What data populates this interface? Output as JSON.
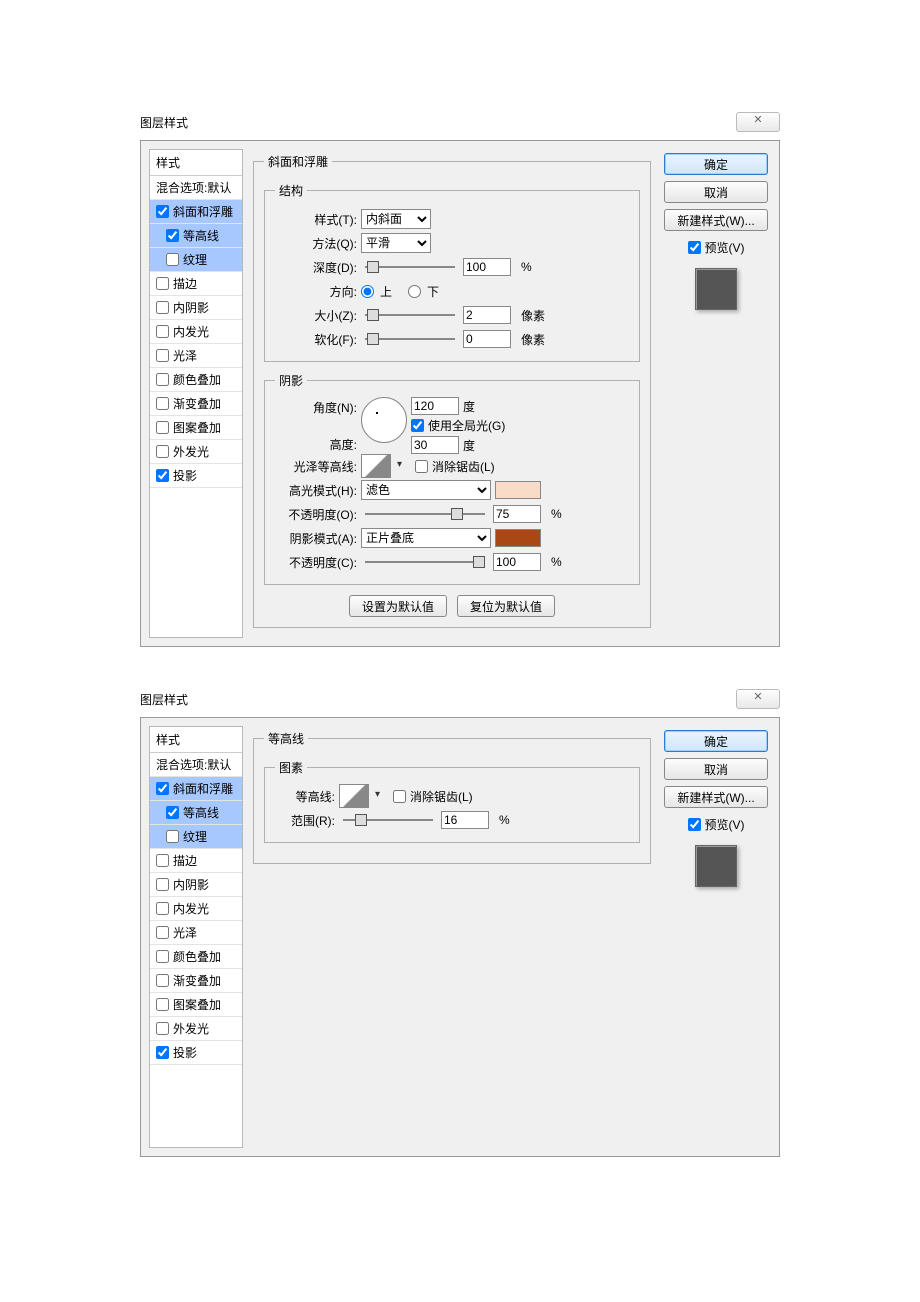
{
  "dialogTitle": "图层样式",
  "closeGlyph": "✕",
  "sidebar": {
    "header": "样式",
    "items": [
      {
        "label": "混合选项:默认",
        "checkbox": false,
        "sub": false,
        "checked": false
      },
      {
        "label": "斜面和浮雕",
        "checkbox": true,
        "sub": false,
        "checked": true
      },
      {
        "label": "等高线",
        "checkbox": true,
        "sub": true,
        "checked": true
      },
      {
        "label": "纹理",
        "checkbox": true,
        "sub": true,
        "checked": false
      },
      {
        "label": "描边",
        "checkbox": true,
        "sub": false,
        "checked": false
      },
      {
        "label": "内阴影",
        "checkbox": true,
        "sub": false,
        "checked": false
      },
      {
        "label": "内发光",
        "checkbox": true,
        "sub": false,
        "checked": false
      },
      {
        "label": "光泽",
        "checkbox": true,
        "sub": false,
        "checked": false
      },
      {
        "label": "颜色叠加",
        "checkbox": true,
        "sub": false,
        "checked": false
      },
      {
        "label": "渐变叠加",
        "checkbox": true,
        "sub": false,
        "checked": false
      },
      {
        "label": "图案叠加",
        "checkbox": true,
        "sub": false,
        "checked": false
      },
      {
        "label": "外发光",
        "checkbox": true,
        "sub": false,
        "checked": false
      },
      {
        "label": "投影",
        "checkbox": true,
        "sub": false,
        "checked": true
      }
    ]
  },
  "selectedIdx1": [
    1,
    2,
    3
  ],
  "selectedIdx2": [
    1,
    2,
    3
  ],
  "bevel": {
    "panelTitle": "斜面和浮雕",
    "structTitle": "结构",
    "styleLabel": "样式(T):",
    "styleValue": "内斜面",
    "techniqueLabel": "方法(Q):",
    "techniqueValue": "平滑",
    "depthLabel": "深度(D):",
    "depthValue": "100",
    "percent": "%",
    "dirLabel": "方向:",
    "up": "上",
    "down": "下",
    "sizeLabel": "大小(Z):",
    "sizeValue": "2",
    "px": "像素",
    "softenLabel": "软化(F):",
    "softenValue": "0",
    "shadingTitle": "阴影",
    "angleLabel": "角度(N):",
    "angleValue": "120",
    "degree": "度",
    "globalLight": "使用全局光(G)",
    "altitudeLabel": "高度:",
    "altitudeValue": "30",
    "glossContourLabel": "光泽等高线:",
    "antiAlias": "消除锯齿(L)",
    "hlModeLabel": "高光模式(H):",
    "hlModeValue": "滤色",
    "hlColor": "#f9dcc8",
    "hlOpacityLabel": "不透明度(O):",
    "hlOpacityValue": "75",
    "shModeLabel": "阴影模式(A):",
    "shModeValue": "正片叠底",
    "shColor": "#a94813",
    "shOpacityLabel": "不透明度(C):",
    "shOpacityValue": "100",
    "makeDefault": "设置为默认值",
    "resetDefault": "复位为默认值"
  },
  "contour": {
    "panelTitle": "等高线",
    "elementsTitle": "图素",
    "contourLabel": "等高线:",
    "antiAlias": "消除锯齿(L)",
    "rangeLabel": "范围(R):",
    "rangeValue": "16",
    "percent": "%"
  },
  "right": {
    "ok": "确定",
    "cancel": "取消",
    "newStyle": "新建样式(W)...",
    "preview": "预览(V)"
  }
}
